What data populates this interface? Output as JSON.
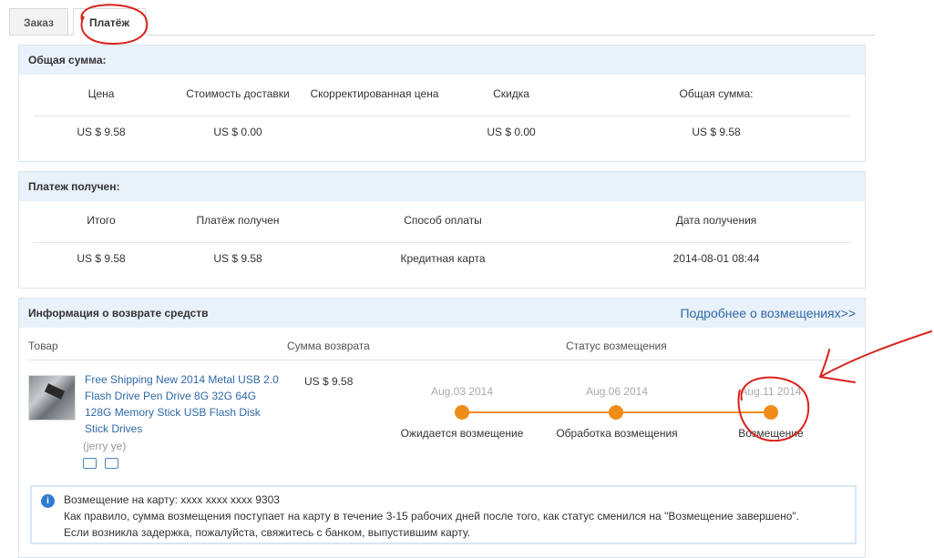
{
  "tabs": [
    {
      "label": "Заказ"
    },
    {
      "label": "Платёж"
    }
  ],
  "total_panel": {
    "title": "Общая сумма:",
    "headers": [
      "Цена",
      "Стоимость доставки",
      "Скорректированная цена",
      "Скидка",
      "Общая сумма:"
    ],
    "values": [
      "US $ 9.58",
      "US $ 0.00",
      "",
      "US $ 0.00",
      "US $ 9.58"
    ]
  },
  "received_panel": {
    "title": "Платеж получен:",
    "headers": [
      "Итого",
      "Платёж получен",
      "Способ оплаты",
      "Дата получения"
    ],
    "values": [
      "US $ 9.58",
      "US $ 9.58",
      "Кредитная карта",
      "2014-08-01 08:44"
    ]
  },
  "refund_panel": {
    "title": "Информация о возврате средств",
    "more_link": "Подробнее о возмещениях>>",
    "columns": [
      "Товар",
      "Сумма возврата",
      "Статус возмещения"
    ],
    "product": {
      "title": "Free Shipping New 2014 Metal USB 2.0 Flash Drive Pen Drive 8G 32G 64G 128G Memory Stick USB Flash Disk Stick Drives",
      "seller": "(jerry ye)"
    },
    "amount": "US $ 9.58",
    "timeline": [
      {
        "date": "Aug.03 2014",
        "label": "Ожидается возмещение"
      },
      {
        "date": "Aug.06 2014",
        "label": "Обработка возмещения"
      },
      {
        "date": "Aug.11 2014",
        "label": "Возмещение"
      }
    ],
    "note": {
      "line1": "Возмещение на карту: xxxx xxxx xxxx 9303",
      "line2": "Как правило, сумма возмещения поступает на карту в течение 3-15 рабочих дней после того, как статус сменился на \"Возмещение завершено\".",
      "line3": "Если возникла задержка, пожалуйста, свяжитесь с банком, выпустившим карту."
    }
  },
  "colors": {
    "accent": "#f08c1a",
    "link": "#2f69a8",
    "panel_header": "#e9f1fa",
    "annotation": "#d9211c"
  }
}
